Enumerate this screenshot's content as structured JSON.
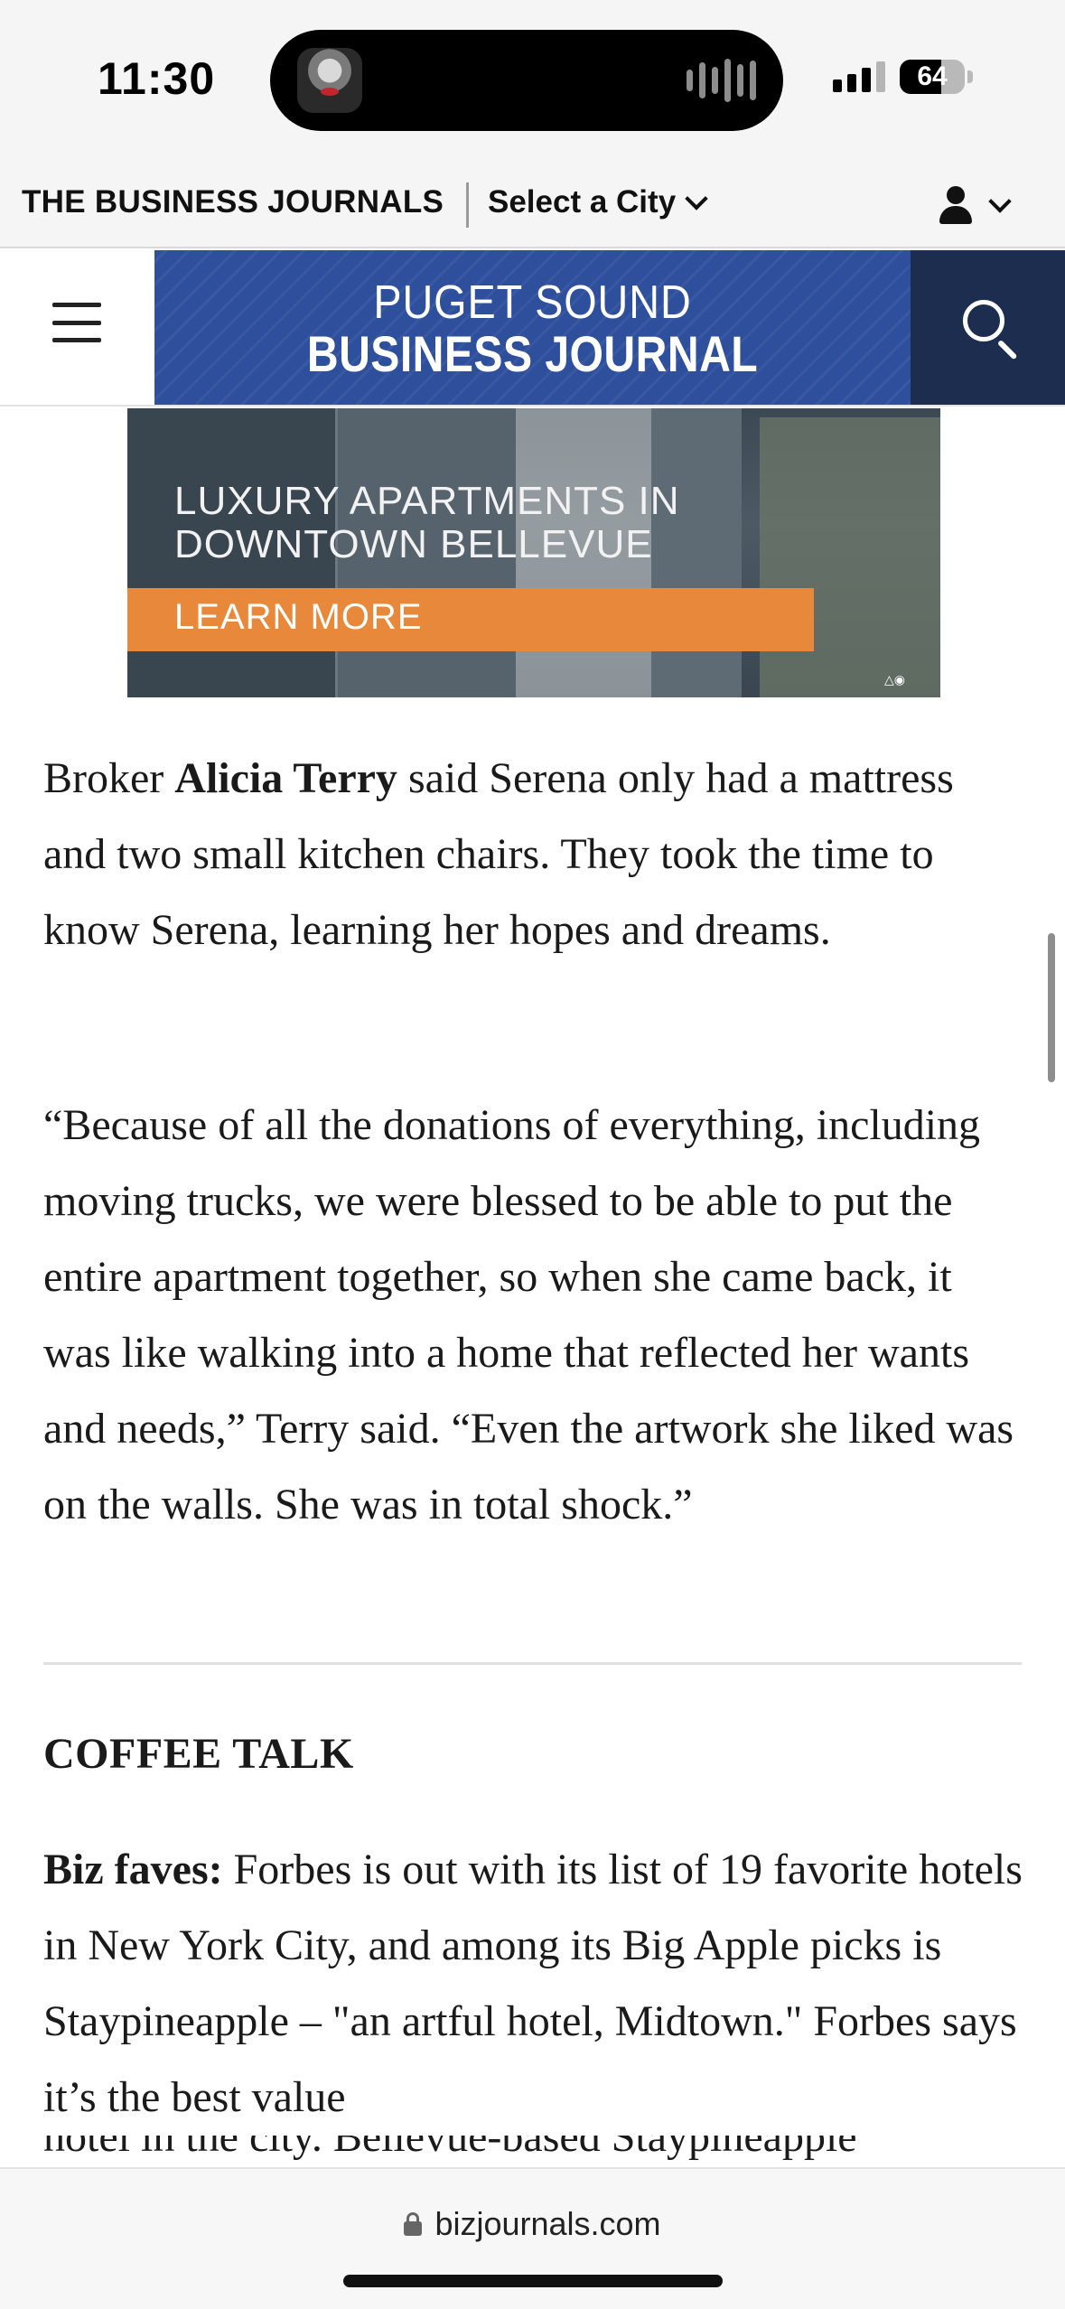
{
  "status_bar": {
    "time": "11:30",
    "battery": "64",
    "battery_level": 0.64,
    "signal_bars_active": 3,
    "signal_bars_total": 4
  },
  "top_bar": {
    "network_name": "THE BUSINESS JOURNALS",
    "city_select_label": "Select a City",
    "account_icon": "person-icon"
  },
  "masthead": {
    "logo_line1": "PUGET SOUND",
    "logo_line2": "BUSINESS JOURNAL",
    "menu_icon": "hamburger-icon",
    "search_icon": "search-icon"
  },
  "ad": {
    "line1": "LUXURY APARTMENTS IN",
    "line2": "DOWNTOWN BELLEVUE",
    "cta": "LEARN MORE"
  },
  "article": {
    "p1_prefix": "Broker ",
    "p1_bold": "Alicia Terry",
    "p1_rest": " said Serena only had a mattress and two small kitchen chairs. They took the time to know Serena, learning her hopes and dreams.",
    "p2": "“Because of all the donations of everything, including moving trucks, we were blessed to be able to put the entire apartment together, so when she came back, it was like walking into a home that reflected her wants and needs,” Terry said. “Even the artwork she liked was on the walls. She was in total shock.”",
    "section_heading": "COFFEE TALK",
    "p3_bold": "Biz faves:",
    "p3_rest": " Forbes is out with its list of 19 favorite hotels in New York City, and among its Big Apple picks is Staypineapple – \"an artful hotel, Midtown.\" Forbes says it’s the best value",
    "p3_cut": "hotel in the city. Bellevue-based Staypineapple"
  },
  "browser": {
    "url": "bizjournals.com"
  },
  "colors": {
    "logo_blue": "#2e4f9c",
    "search_navy": "#1c2d4f",
    "ad_orange": "#e8883a"
  }
}
